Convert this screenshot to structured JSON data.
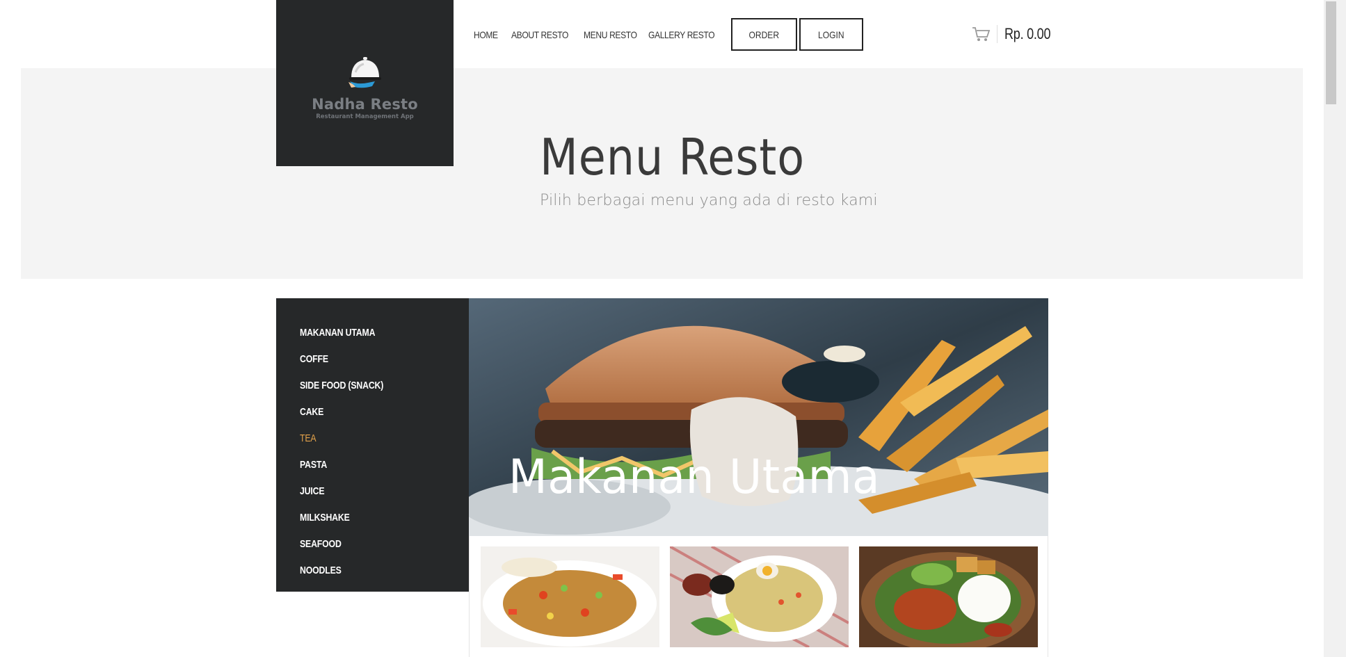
{
  "brand": {
    "name": "Nadha Resto",
    "tagline": "Restaurant Management App"
  },
  "nav": {
    "links": [
      "HOME",
      "ABOUT RESTO",
      "MENU RESTO",
      "GALLERY RESTO"
    ],
    "order_label": "ORDER",
    "login_label": "LOGIN"
  },
  "cart": {
    "total": "Rp. 0.00",
    "icon": "cart-icon"
  },
  "hero": {
    "title": "Menu Resto",
    "subtitle": "Pilih berbagai menu yang ada di resto kami"
  },
  "sidebar": {
    "items": [
      {
        "label": "MAKANAN UTAMA",
        "active": false
      },
      {
        "label": "COFFE",
        "active": false
      },
      {
        "label": "SIDE FOOD (SNACK)",
        "active": false
      },
      {
        "label": "CAKE",
        "active": false
      },
      {
        "label": "TEA",
        "active": true
      },
      {
        "label": "PASTA",
        "active": false
      },
      {
        "label": "JUICE",
        "active": false
      },
      {
        "label": "MILKSHAKE",
        "active": false
      },
      {
        "label": "SEAFOOD",
        "active": false
      },
      {
        "label": "NOODLES",
        "active": false
      }
    ],
    "active_color": "#e3a24a"
  },
  "category": {
    "title": "Makanan Utama"
  },
  "colors": {
    "dark": "#262829",
    "hero_bg": "#f4f4f4"
  }
}
